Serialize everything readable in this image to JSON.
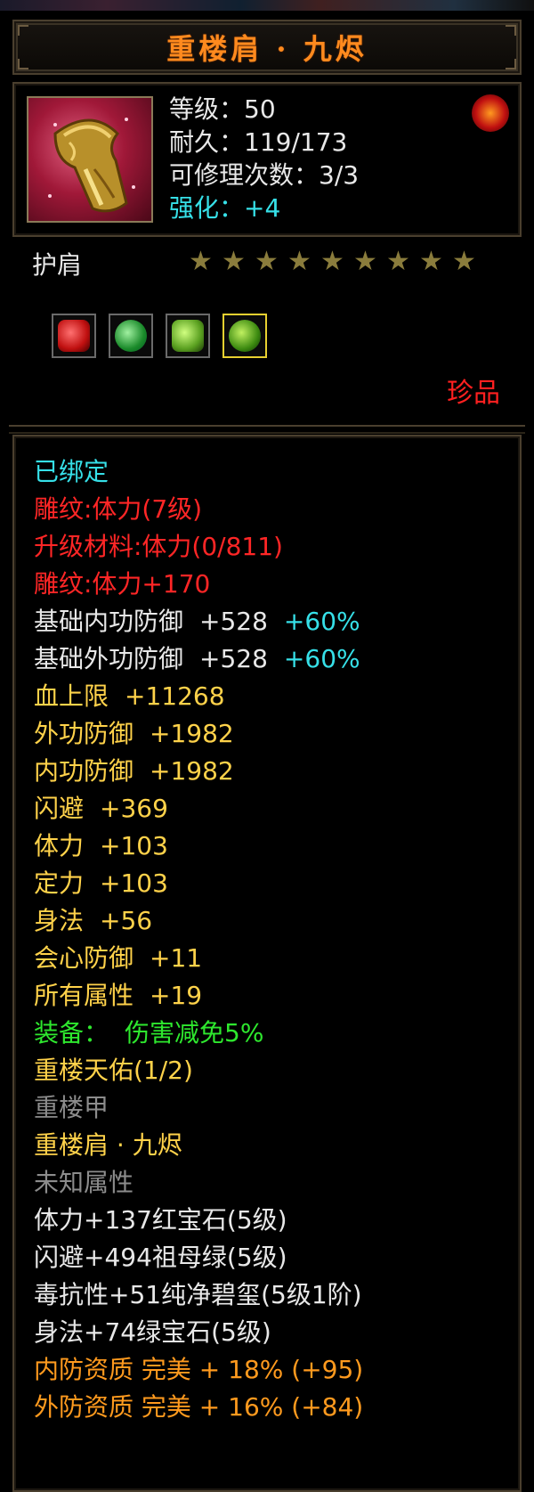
{
  "title": "重楼肩 · 九烬",
  "header": {
    "level": "等级：50",
    "durability": "耐久：119/173",
    "repairs": "可修理次数：3/3",
    "enhance": "强化：+4"
  },
  "item_type": "护肩",
  "stars_count": 9,
  "rarity": "珍品",
  "icon_names": {
    "item": "golden-pauldron-icon",
    "badge": "dragon-emblem-icon",
    "gems": [
      "red-gem-icon",
      "emerald-gem-icon",
      "jade-gem-icon",
      "green-gem-icon"
    ]
  },
  "colors": {
    "title": "#ff8a1e",
    "white": "#e8e8e8",
    "red": "#ff2626",
    "yellow": "#ffd24a",
    "cyan": "#36e0e8",
    "green": "#2ee82e",
    "gray": "#8c8c8c",
    "orange": "#ff9a1e"
  },
  "props": {
    "bound": "已绑定",
    "engrave": "雕纹:体力(7级)",
    "upgrade_mat": "升级材料:体力(0/811)",
    "engrave_bonus": "雕纹:体力+170",
    "base_inner_def": {
      "label": "基础内功防御",
      "value": "+528",
      "pct": "+60%"
    },
    "base_outer_def": {
      "label": "基础外功防御",
      "value": "+528",
      "pct": "+60%"
    },
    "hp": {
      "label": "血上限",
      "value": "+11268"
    },
    "outer_def": {
      "label": "外功防御",
      "value": "+1982"
    },
    "inner_def": {
      "label": "内功防御",
      "value": "+1982"
    },
    "dodge": {
      "label": "闪避",
      "value": "+369"
    },
    "stamina": {
      "label": "体力",
      "value": "+103"
    },
    "focus": {
      "label": "定力",
      "value": "+103"
    },
    "agility": {
      "label": "身法",
      "value": "+56"
    },
    "crit_def": {
      "label": "会心防御",
      "value": "+11"
    },
    "all_attr": {
      "label": "所有属性",
      "value": "+19"
    },
    "equip_label": "装备：",
    "equip_value": "伤害减免5%",
    "set_name": "重楼天佑(1/2)",
    "set_item1": "重楼甲",
    "set_item2": "重楼肩 · 九烬",
    "unknown": "未知属性",
    "gem1": "体力+137红宝石(5级)",
    "gem2": "闪避+494祖母绿(5级)",
    "gem3": "毒抗性+51纯净碧玺(5级1阶)",
    "gem4": "身法+74绿宝石(5级)",
    "inner_quality": "内防资质 完美 + 18% (+95)",
    "outer_quality": "外防资质 完美 + 16% (+84)"
  }
}
